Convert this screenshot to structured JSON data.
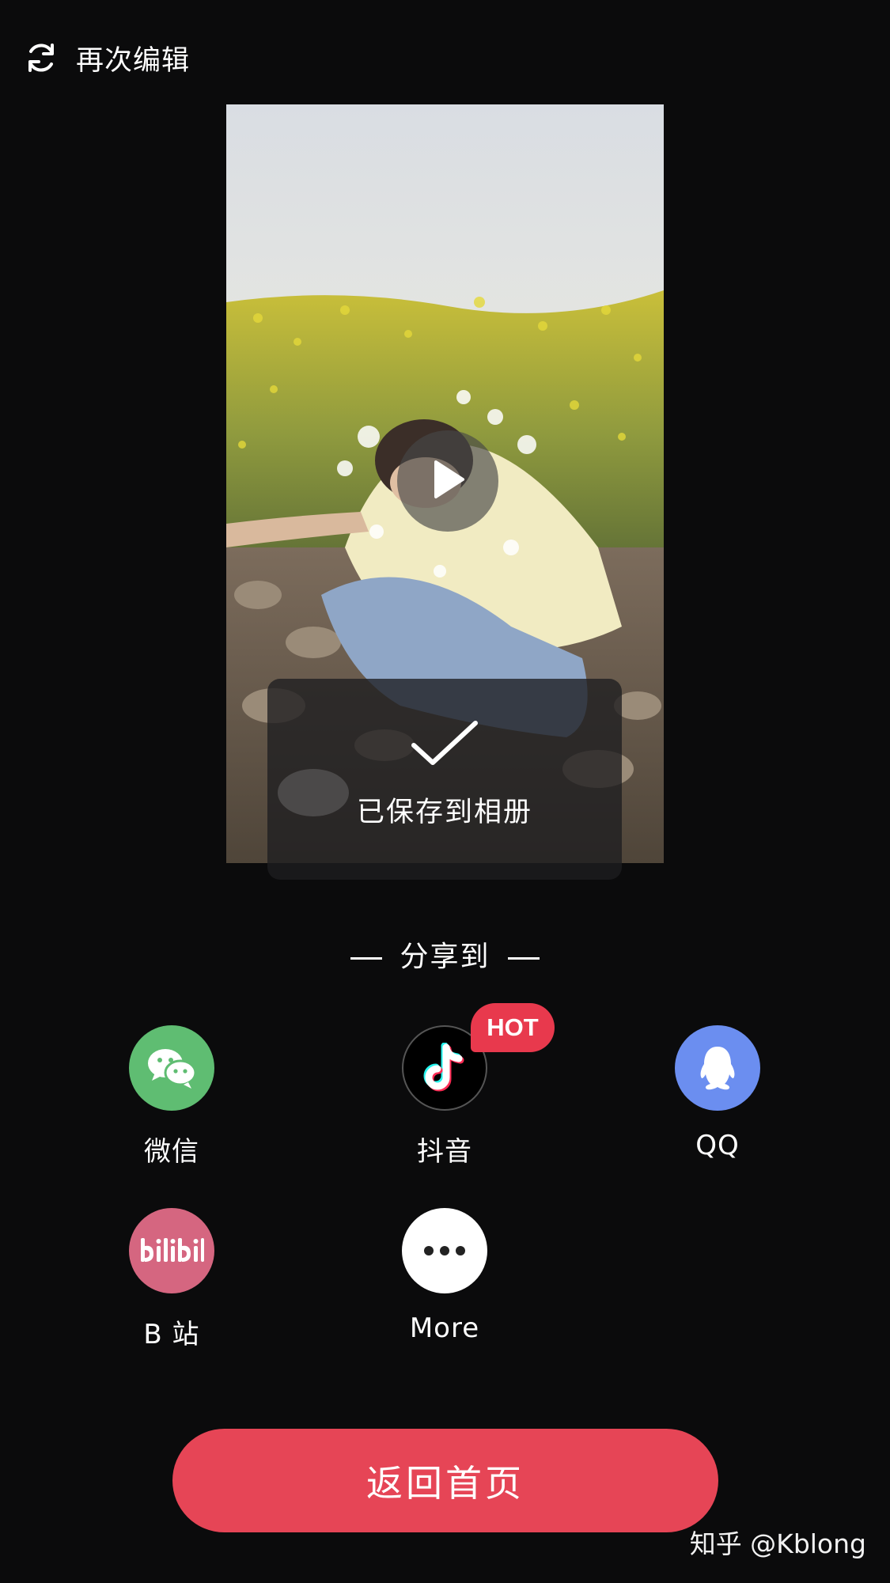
{
  "top_bar": {
    "edit_again_label": "再次编辑",
    "icon": "refresh-icon"
  },
  "preview": {
    "saved_message": "已保存到相册",
    "play_icon": "play-icon",
    "check_icon": "check-icon"
  },
  "share": {
    "title": "分享到",
    "items": [
      {
        "label": "微信",
        "icon": "wechat-icon",
        "color": "#5fbd72"
      },
      {
        "label": "抖音",
        "icon": "douyin-icon",
        "color": "#000000",
        "badge": "HOT"
      },
      {
        "label": "QQ",
        "icon": "qq-icon",
        "color": "#6b8ef0"
      },
      {
        "label": "B 站",
        "icon": "bilibili-icon",
        "color": "#d56680"
      },
      {
        "label": "More",
        "icon": "more-icon",
        "color": "#ffffff"
      }
    ]
  },
  "home_button": {
    "label": "返回首页",
    "color": "#e64556"
  },
  "watermark": "知乎 @Kblong"
}
